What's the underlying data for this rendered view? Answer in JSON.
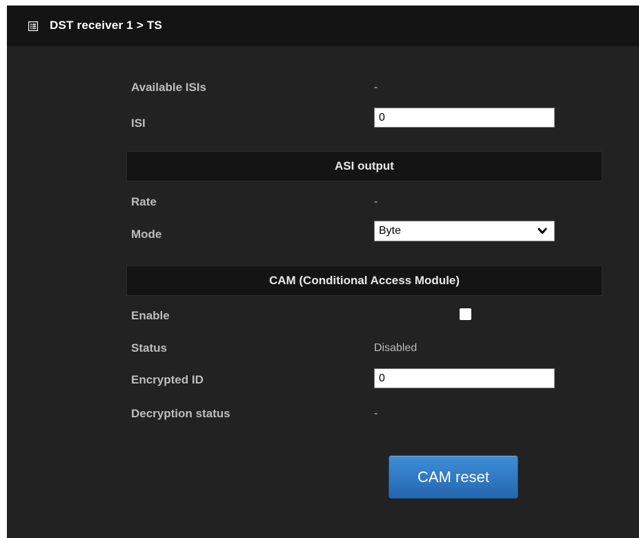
{
  "header": {
    "icon": "list-icon",
    "title": "DST receiver 1 > TS"
  },
  "isi": {
    "available_label": "Available ISIs",
    "available_value": "-",
    "isi_label": "ISI",
    "isi_value": "0"
  },
  "asi_output": {
    "section_title": "ASI output",
    "rate_label": "Rate",
    "rate_value": "-",
    "mode_label": "Mode",
    "mode_value": "Byte"
  },
  "cam": {
    "section_title": "CAM (Conditional Access Module)",
    "enable_label": "Enable",
    "enable_checked": false,
    "status_label": "Status",
    "status_value": "Disabled",
    "encrypted_id_label": "Encrypted ID",
    "encrypted_id_value": "0",
    "decryption_label": "Decryption status",
    "decryption_value": "-",
    "reset_label": "CAM reset"
  },
  "colors": {
    "panel_bg": "#222222",
    "header_bg": "#141414",
    "button_blue": "#2f7ac4"
  }
}
